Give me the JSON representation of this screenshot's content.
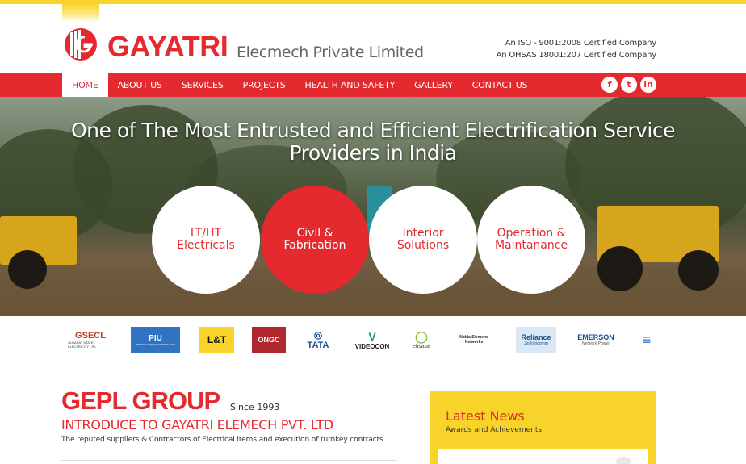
{
  "header": {
    "brand_name": "GAYATRI",
    "brand_sub": "Elecmech Private Limited",
    "cert_line1": "An ISO - 9001:2008 Certified Company",
    "cert_line2": "An OHSAS 18001:207 Certified Company"
  },
  "nav": {
    "items": [
      {
        "label": "HOME",
        "active": true
      },
      {
        "label": "ABOUT US"
      },
      {
        "label": "SERVICES"
      },
      {
        "label": "PROJECTS"
      },
      {
        "label": "HEALTH AND SAFETY"
      },
      {
        "label": "GALLERY"
      },
      {
        "label": "CONTACT US"
      }
    ],
    "social": [
      "facebook-icon",
      "twitter-icon",
      "linkedin-icon"
    ]
  },
  "hero": {
    "title_line1": "One of The Most Entrusted and Efficient Electrification Service",
    "title_line2": "Providers in India",
    "services": [
      {
        "line1": "LT/HT",
        "line2": "Electricals"
      },
      {
        "line1": "Civil &",
        "line2": "Fabrication"
      },
      {
        "line1": "Interior",
        "line2": "Solutions"
      },
      {
        "line1": "Operation &",
        "line2": "Maintanance"
      }
    ]
  },
  "clients": [
    {
      "name": "GSECL",
      "caption": "GUJARAT STATE ELECTRICITY LTD."
    },
    {
      "name": "PIU",
      "caption": "PROJECT IMPLEMENTATION UNIT"
    },
    {
      "name": "L&T"
    },
    {
      "name": "ONGC"
    },
    {
      "name": "TATA"
    },
    {
      "name": "VIDEOCON"
    },
    {
      "name": "etisalat"
    },
    {
      "name": "Nokia Siemens Networks"
    },
    {
      "name": "Reliance",
      "caption": "Jio Infocomm"
    },
    {
      "name": "EMERSON",
      "caption": "Network Power"
    }
  ],
  "about": {
    "title": "GEPL GROUP",
    "since": "Since 1993",
    "introduce": "INTRODUCE TO GAYATRI ELEMECH PVT. LTD",
    "tagline": "The reputed suppliers & Contractors of Electrical items and execution of turnkey contracts"
  },
  "news": {
    "title": "Latest News",
    "subtitle": "Awards and Achievements"
  },
  "colors": {
    "brand_red": "#e42a2f",
    "brand_yellow": "#f8d32a"
  }
}
